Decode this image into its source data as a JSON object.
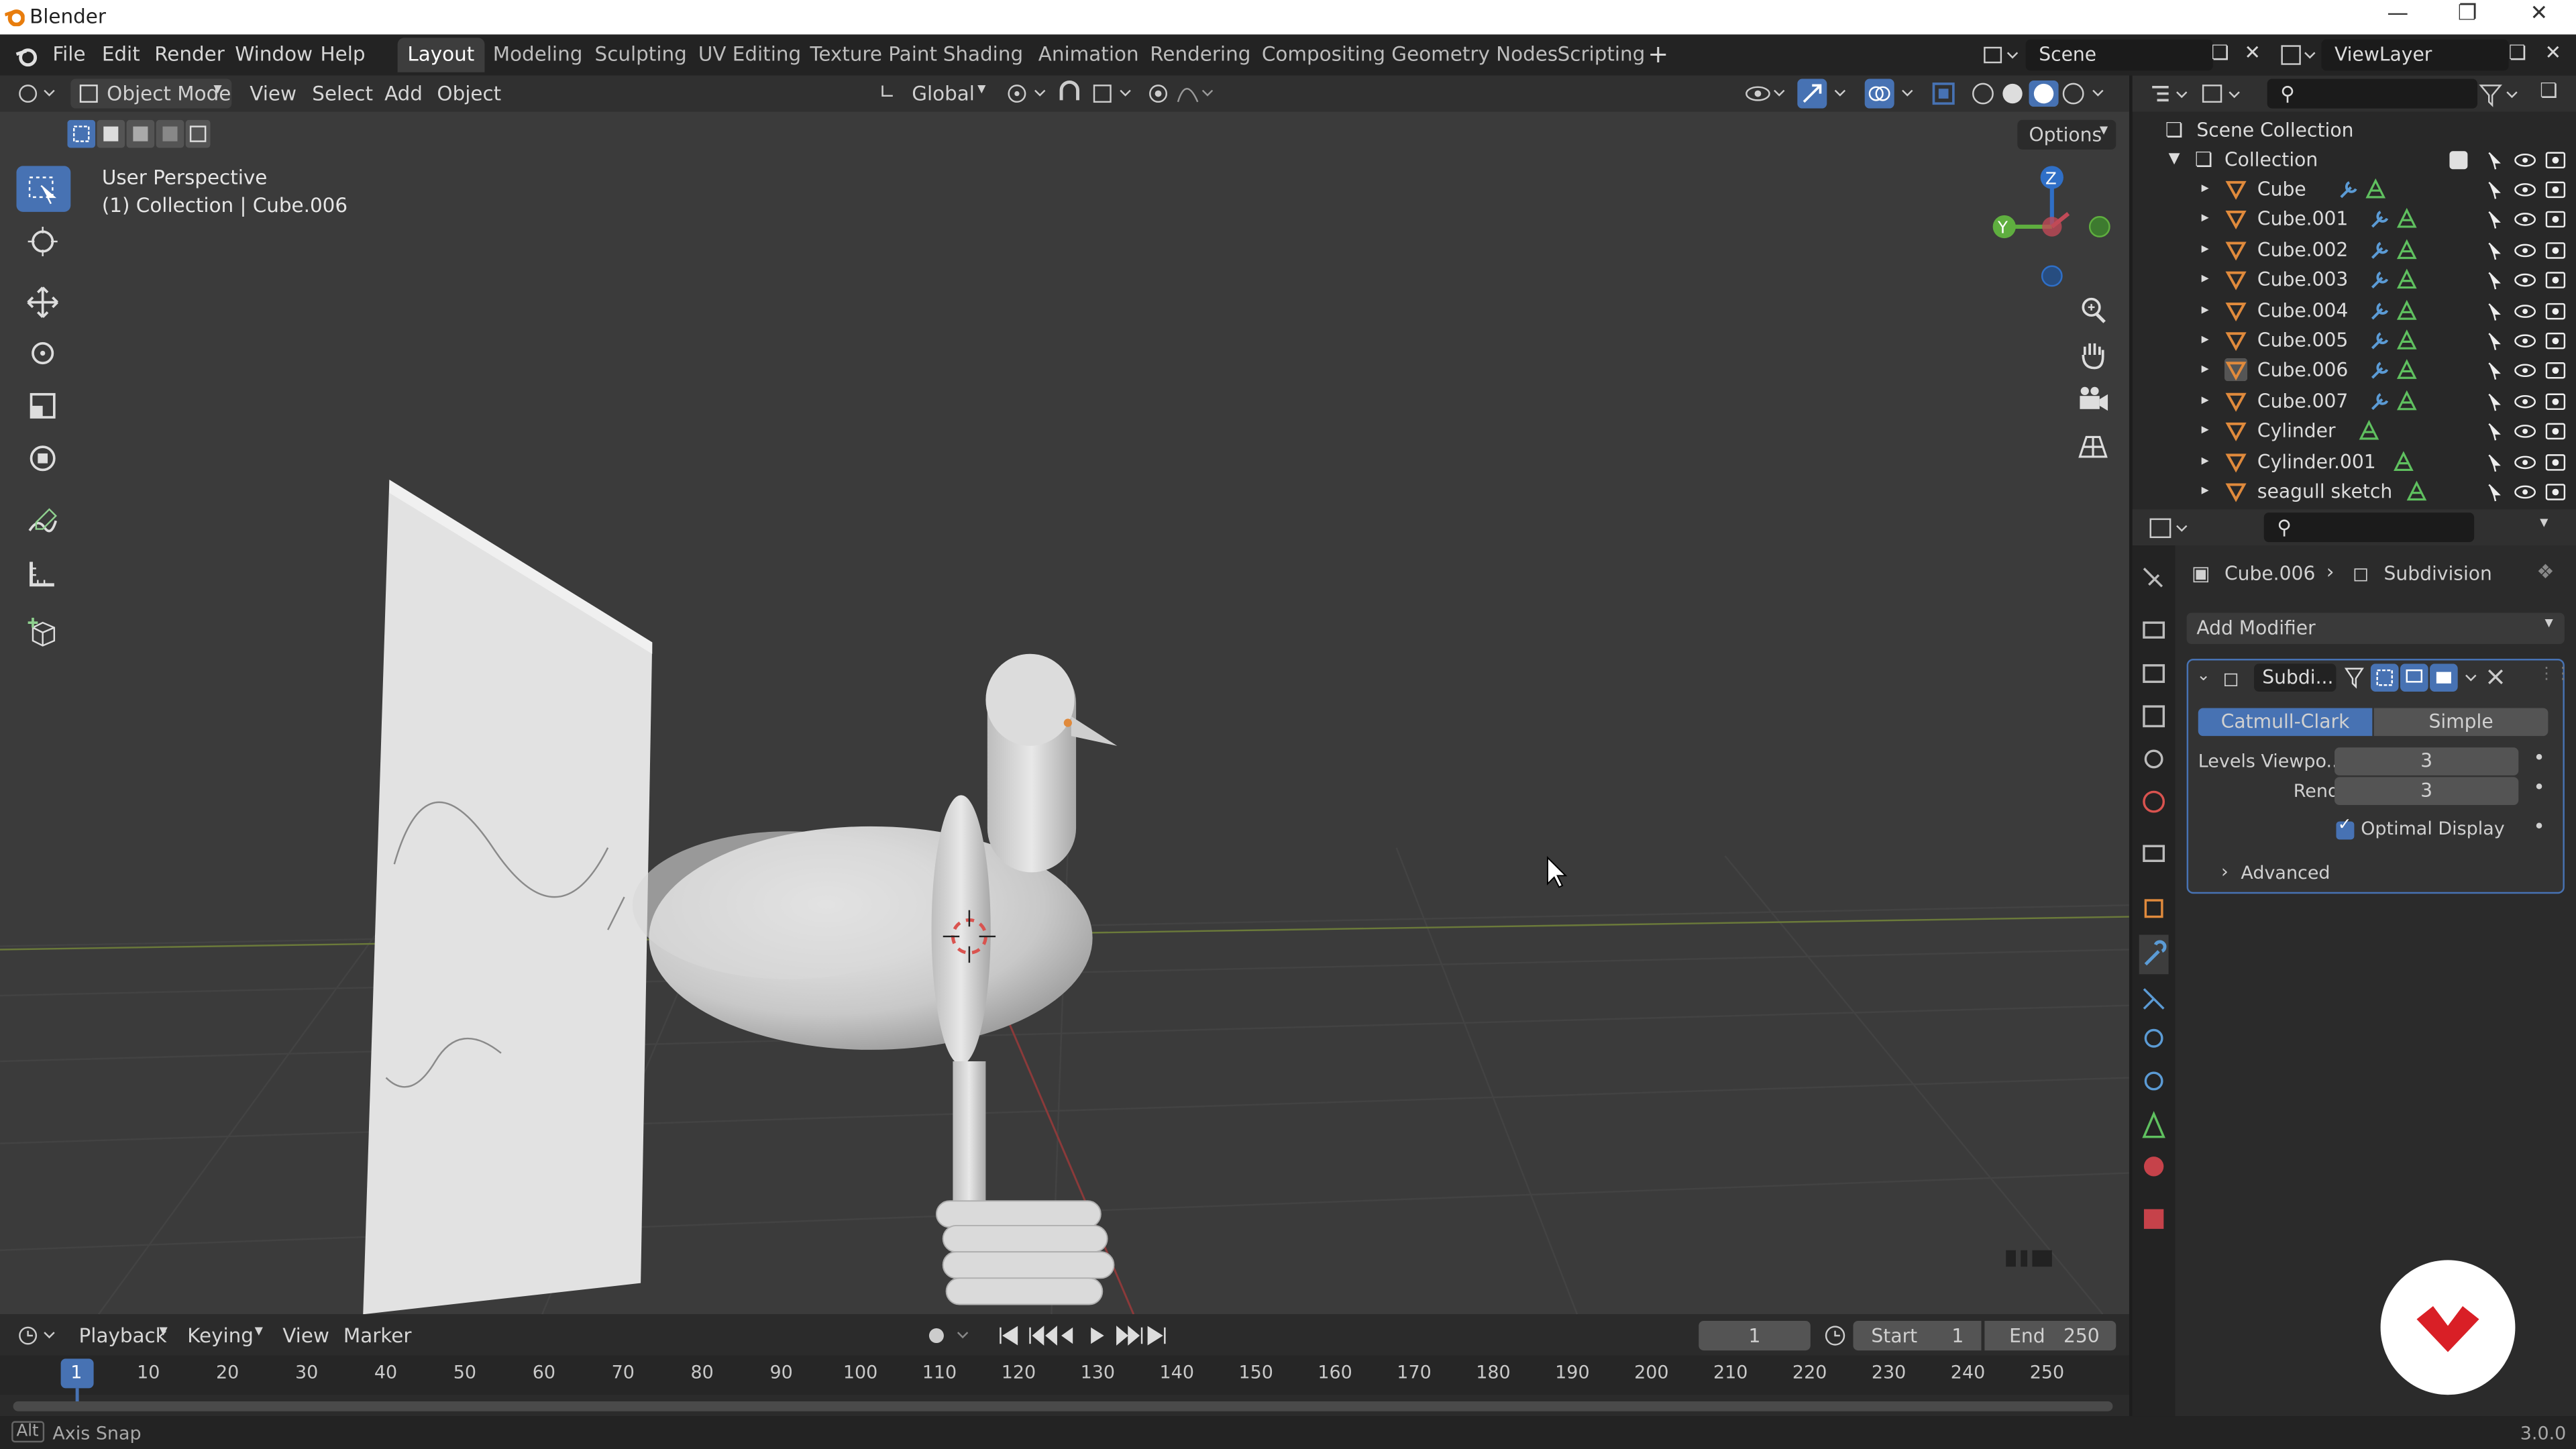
{
  "window": {
    "title": "Blender",
    "version": "3.0.0"
  },
  "menus": [
    "File",
    "Edit",
    "Render",
    "Window",
    "Help"
  ],
  "workspaces": [
    "Layout",
    "Modeling",
    "Sculpting",
    "UV Editing",
    "Texture Paint",
    "Shading",
    "Animation",
    "Rendering",
    "Compositing",
    "Geometry Nodes",
    "Scripting"
  ],
  "active_workspace": "Layout",
  "scene": {
    "name": "Scene",
    "view_layer": "ViewLayer"
  },
  "viewport": {
    "mode": "Object Mode",
    "header_menus": [
      "View",
      "Select",
      "Add",
      "Object"
    ],
    "transform_orientation": "Global",
    "options_label": "Options",
    "overlay_line1": "User Perspective",
    "overlay_line2": "(1) Collection | Cube.006",
    "gizmo": {
      "z": "Z",
      "y": "Y"
    }
  },
  "outliner": {
    "root": "Scene Collection",
    "collection": "Collection",
    "items": [
      "Cube",
      "Cube.001",
      "Cube.002",
      "Cube.003",
      "Cube.004",
      "Cube.005",
      "Cube.006",
      "Cube.007",
      "Cylinder",
      "Cylinder.001",
      "seagull sketch"
    ]
  },
  "properties": {
    "breadcrumb_object": "Cube.006",
    "breadcrumb_modifier": "Subdivision",
    "add_modifier": "Add Modifier",
    "modifier_name": "Subdi...",
    "type_catmull": "Catmull-Clark",
    "type_simple": "Simple",
    "levels_viewport_label": "Levels Viewpo...",
    "levels_viewport_value": "3",
    "render_label": "Render",
    "render_value": "3",
    "optimal_display": "Optimal Display",
    "advanced": "Advanced"
  },
  "timeline": {
    "menus": [
      "Playback",
      "Keying",
      "View",
      "Marker"
    ],
    "current_frame": "1",
    "start_label": "Start",
    "start_value": "1",
    "end_label": "End",
    "end_value": "250",
    "ticks": [
      "1",
      "10",
      "20",
      "30",
      "40",
      "50",
      "60",
      "70",
      "80",
      "90",
      "100",
      "110",
      "120",
      "130",
      "140",
      "150",
      "160",
      "170",
      "180",
      "190",
      "200",
      "210",
      "220",
      "230",
      "240",
      "250"
    ]
  },
  "statusbar": {
    "key": "Alt",
    "hint": "Axis Snap"
  },
  "colors": {
    "accent": "#4772b3",
    "object_orange": "#e08a3c",
    "mesh_green": "#5fc05f"
  }
}
